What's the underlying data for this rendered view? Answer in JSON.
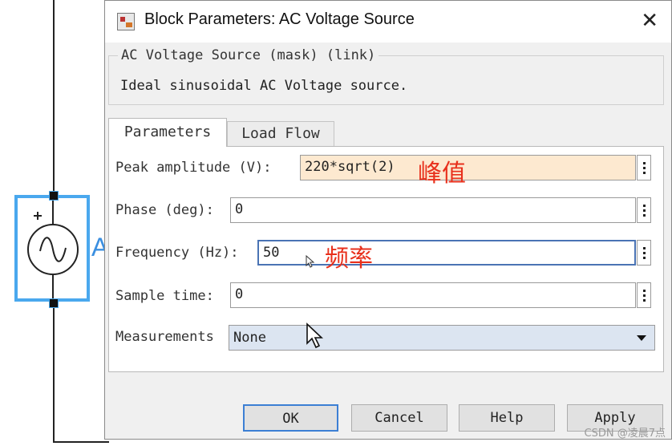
{
  "canvas": {
    "block_big_letter": "A"
  },
  "dialog": {
    "title": "Block Parameters: AC Voltage Source",
    "close_glyph": "✕",
    "group_title": "AC Voltage Source (mask) (link)",
    "group_description": "Ideal sinusoidal AC Voltage source.",
    "tabs": [
      {
        "label": "Parameters",
        "active": true
      },
      {
        "label": "Load Flow",
        "active": false
      }
    ],
    "params": {
      "peak": {
        "label": "Peak amplitude (V):",
        "value": "220*sqrt(2)",
        "annotation": "峰值"
      },
      "phase": {
        "label": "Phase (deg):",
        "value": "0"
      },
      "frequency": {
        "label": "Frequency (Hz):",
        "value": "50",
        "annotation": "频率"
      },
      "sample": {
        "label": "Sample time:",
        "value": "0"
      },
      "measurements": {
        "label": "Measurements",
        "selected": "None"
      }
    },
    "buttons": {
      "ok": "OK",
      "cancel": "Cancel",
      "help": "Help",
      "apply": "Apply"
    }
  },
  "watermark": "CSDN @凌晨7点",
  "colors": {
    "selection_blue": "#4aa8ee",
    "peak_field_bg": "#fde9d0",
    "annotation_red": "#e8301c",
    "select_bg": "#dce5f1"
  }
}
